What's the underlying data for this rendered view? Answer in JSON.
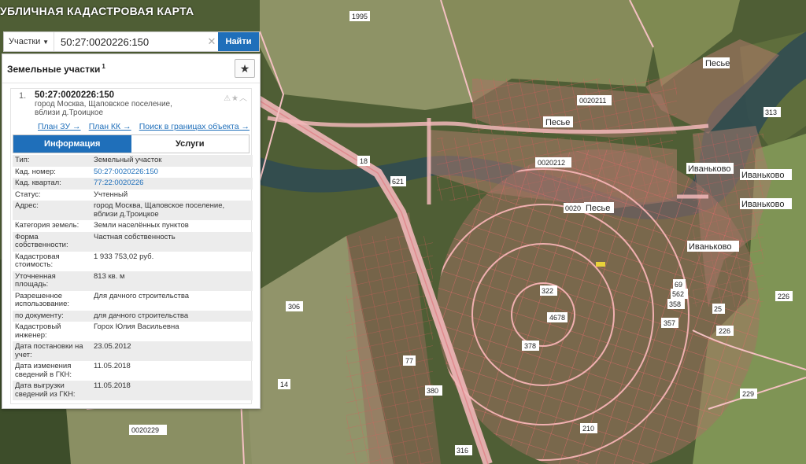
{
  "map": {
    "title": "УБЛИЧНАЯ КАДАСТРОВАЯ КАРТА",
    "labels": [
      {
        "text": "1995",
        "kind": "parcel"
      },
      {
        "text": "Песье",
        "kind": "place"
      },
      {
        "text": "0020211",
        "kind": "quarter"
      },
      {
        "text": "Песье",
        "kind": "place"
      },
      {
        "text": "0020212",
        "kind": "quarter"
      },
      {
        "text": "0020",
        "kind": "quarter"
      },
      {
        "text": "Песье",
        "kind": "place"
      },
      {
        "text": "Иваньково",
        "kind": "place"
      },
      {
        "text": "Иваньково",
        "kind": "place"
      },
      {
        "text": "Иваньково",
        "kind": "place"
      },
      {
        "text": "Иваньково",
        "kind": "place"
      },
      {
        "text": "226",
        "kind": "parcel"
      },
      {
        "text": "226",
        "kind": "parcel"
      },
      {
        "text": "229",
        "kind": "parcel"
      },
      {
        "text": "18",
        "kind": "parcel"
      },
      {
        "text": "621",
        "kind": "parcel"
      },
      {
        "text": "306",
        "kind": "parcel"
      },
      {
        "text": "14",
        "kind": "parcel"
      },
      {
        "text": "0020229",
        "kind": "quarter"
      },
      {
        "text": "4678",
        "kind": "parcel"
      },
      {
        "text": "322",
        "kind": "parcel"
      },
      {
        "text": "378",
        "kind": "parcel"
      },
      {
        "text": "357",
        "kind": "parcel"
      },
      {
        "text": "358",
        "kind": "parcel"
      },
      {
        "text": "562",
        "kind": "parcel"
      },
      {
        "text": "69",
        "kind": "parcel"
      },
      {
        "text": "210",
        "kind": "parcel"
      },
      {
        "text": "316",
        "kind": "parcel"
      },
      {
        "text": "77",
        "kind": "parcel"
      },
      {
        "text": "380",
        "kind": "parcel"
      },
      {
        "text": "313",
        "kind": "parcel"
      },
      {
        "text": "25",
        "kind": "parcel"
      }
    ]
  },
  "search": {
    "type_label": "Участки",
    "query": "50:27:0020226:150",
    "button_label": "Найти"
  },
  "panel": {
    "title": "Земельные участки",
    "count": "1",
    "result": {
      "index": "1.",
      "cadastral_number": "50:27:0020226:150",
      "address": "город Москва, Щаповское поселение, вблизи д.Троицкое",
      "links": [
        "План ЗУ →",
        "План КК →",
        "Поиск в границах объекта →"
      ]
    },
    "tabs": [
      "Информация",
      "Услуги"
    ],
    "properties": [
      {
        "key": "Тип:",
        "value": "Земельный участок"
      },
      {
        "key": "Кад. номер:",
        "value": "50:27:0020226:150",
        "link": true
      },
      {
        "key": "Кад. квартал:",
        "value": "77:22:0020226",
        "link": true
      },
      {
        "key": "Статус:",
        "value": "Учтенный"
      },
      {
        "key": "Адрес:",
        "value": "город Москва, Щаповское поселение, вблизи д.Троицкое"
      },
      {
        "key": "Категория земель:",
        "value": "Земли населённых пунктов"
      },
      {
        "key": "Форма собственности:",
        "value": "Частная собственность"
      },
      {
        "key": "Кадастровая стоимость:",
        "value": "1 933 753,02 руб."
      },
      {
        "key": "Уточненная площадь:",
        "value": "813 кв. м"
      },
      {
        "key": "Разрешенное использование:",
        "value": "Для дачного строительства"
      },
      {
        "key": "по документу:",
        "value": "для дачного строительства"
      },
      {
        "key": "Кадастровый инженер:",
        "value": "Горох Юлия Васильевна"
      },
      {
        "key": "Дата постановки на учет:",
        "value": "23.05.2012"
      },
      {
        "key": "Дата изменения сведений в ГКН:",
        "value": "11.05.2018"
      },
      {
        "key": "Дата выгрузки сведений из ГКН:",
        "value": "11.05.2018"
      }
    ]
  }
}
